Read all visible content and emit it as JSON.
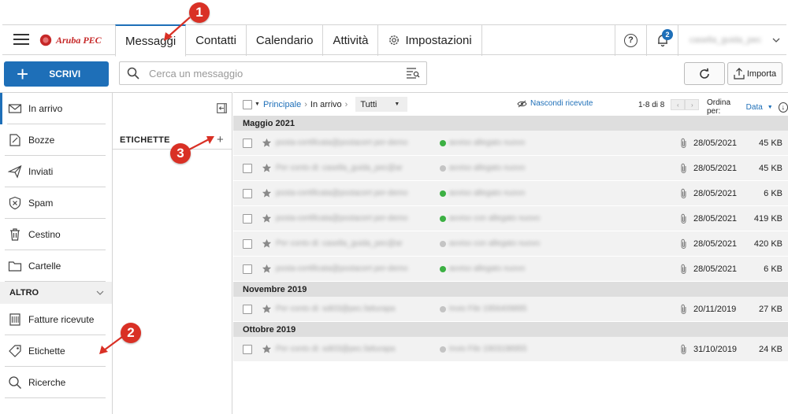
{
  "brand": {
    "name": "Aruba PEC"
  },
  "tabs": [
    {
      "label": "Messaggi",
      "active": true
    },
    {
      "label": "Contatti"
    },
    {
      "label": "Calendario"
    },
    {
      "label": "Attività"
    },
    {
      "label": "Impostazioni",
      "icon": "gear-icon"
    }
  ],
  "topright": {
    "help_icon": "help-icon",
    "notification_count": "2",
    "user_name": "casella_guida_pec"
  },
  "compose": {
    "label": "SCRIVI"
  },
  "search": {
    "placeholder": "Cerca un messaggio"
  },
  "actions": {
    "import_label": "Importa"
  },
  "sidebar": {
    "items": [
      {
        "label": "In arrivo",
        "icon": "inbox-icon",
        "active": true
      },
      {
        "label": "Bozze",
        "icon": "draft-icon"
      },
      {
        "label": "Inviati",
        "icon": "sent-icon"
      },
      {
        "label": "Spam",
        "icon": "spam-icon"
      },
      {
        "label": "Cestino",
        "icon": "trash-icon"
      },
      {
        "label": "Cartelle",
        "icon": "folder-icon"
      }
    ],
    "section_label": "ALTRO",
    "extra_items": [
      {
        "label": "Fatture ricevute",
        "icon": "invoice-icon"
      },
      {
        "label": "Etichette",
        "icon": "tag-icon"
      },
      {
        "label": "Ricerche",
        "icon": "search-icon"
      }
    ]
  },
  "labels_panel": {
    "title": "ETICHETTE",
    "add": "+"
  },
  "list": {
    "breadcrumb_root": "Principale",
    "breadcrumb_current": "In arrivo",
    "filter": "Tutti",
    "hide_read": "Nascondi ricevute",
    "range": "1-8 di 8",
    "sort_label": "Ordina per:",
    "sort_value": "Data",
    "groups": [
      {
        "label": "Maggio 2021",
        "messages": [
          {
            "from": "posta-certificata@postacert per-demo",
            "subject": "avviso allegato nuovo",
            "dot": "#3cb043",
            "date": "28/05/2021",
            "size": "45 KB"
          },
          {
            "from": "Per conto di: casella_guida_pec@ar",
            "subject": "avviso allegato nuovo",
            "dot": "#c4c4c4",
            "date": "28/05/2021",
            "size": "45 KB"
          },
          {
            "from": "posta-certificata@postacert per-demo",
            "subject": "avviso allegato nuovo",
            "dot": "#3cb043",
            "date": "28/05/2021",
            "size": "6 KB"
          },
          {
            "from": "posta-certificata@postacert per-demo",
            "subject": "avviso con allegato nuovo",
            "dot": "#3cb043",
            "date": "28/05/2021",
            "size": "419 KB"
          },
          {
            "from": "Per conto di: casella_guida_pec@ar",
            "subject": "avviso con allegato nuovo",
            "dot": "#c4c4c4",
            "date": "28/05/2021",
            "size": "420 KB"
          },
          {
            "from": "posta-certificata@postacert per-demo",
            "subject": "avviso allegato nuovo",
            "dot": "#3cb043",
            "date": "28/05/2021",
            "size": "6 KB"
          }
        ]
      },
      {
        "label": "Novembre 2019",
        "messages": [
          {
            "from": "Per conto di: sdi03@pec.fatturapa",
            "subject": "Invio File 1956409895",
            "dot": "#c4c4c4",
            "date": "20/11/2019",
            "size": "27 KB"
          }
        ]
      },
      {
        "label": "Ottobre 2019",
        "messages": [
          {
            "from": "Per conto di: sdi03@pec.fatturapa",
            "subject": "Invio File 1903198955",
            "dot": "#c4c4c4",
            "date": "31/10/2019",
            "size": "24 KB"
          }
        ]
      }
    ]
  },
  "callouts": [
    "1",
    "2",
    "3"
  ],
  "colors": {
    "accent": "#1e6fb8",
    "callout": "#d93025",
    "group_bg": "#dedede",
    "row_bg": "#f2f2f2"
  }
}
